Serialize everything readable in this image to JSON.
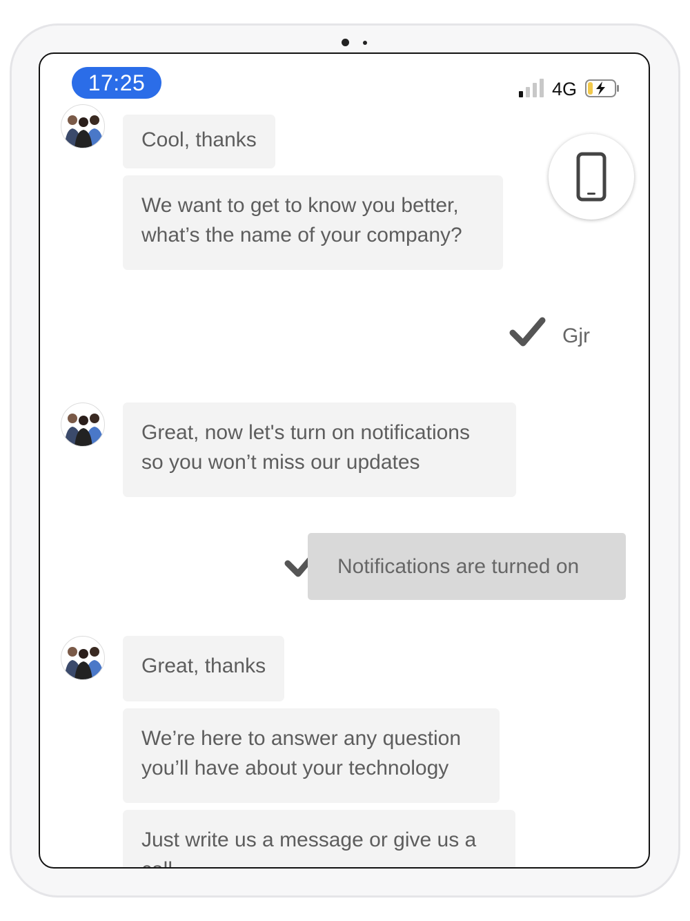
{
  "status_bar": {
    "time": "17:25",
    "network": "4G",
    "signal_bars_active": 1,
    "signal_bars_total": 4,
    "battery_level": 0.15,
    "battery_charging": true
  },
  "call_button": {
    "icon": "smartphone-icon"
  },
  "messages": [
    {
      "sender": "agent",
      "text": "Cool, thanks"
    },
    {
      "sender": "agent",
      "lines": [
        "We want to get to know you better,",
        "what’s the name of your company?"
      ]
    },
    {
      "sender": "user",
      "text": "Gjr",
      "status_icon": "checkmark-icon"
    },
    {
      "sender": "agent",
      "lines": [
        "Great, now let's turn on notifications",
        "so you won’t miss our updates"
      ]
    },
    {
      "sender": "user",
      "text": "Notifications are turned on",
      "status_icon": "checkmark-icon"
    },
    {
      "sender": "agent",
      "text": "Great, thanks"
    },
    {
      "sender": "agent",
      "lines": [
        "We’re here to answer any question",
        "you’ll have about your technology"
      ]
    },
    {
      "sender": "agent",
      "lines": [
        "Just write us a message or give us a",
        "call"
      ]
    }
  ],
  "colors": {
    "time_pill": "#2b6de8",
    "bubble": "#f3f3f3",
    "reply_box": "#d9d9d9",
    "battery_fill": "#f2c94c"
  }
}
